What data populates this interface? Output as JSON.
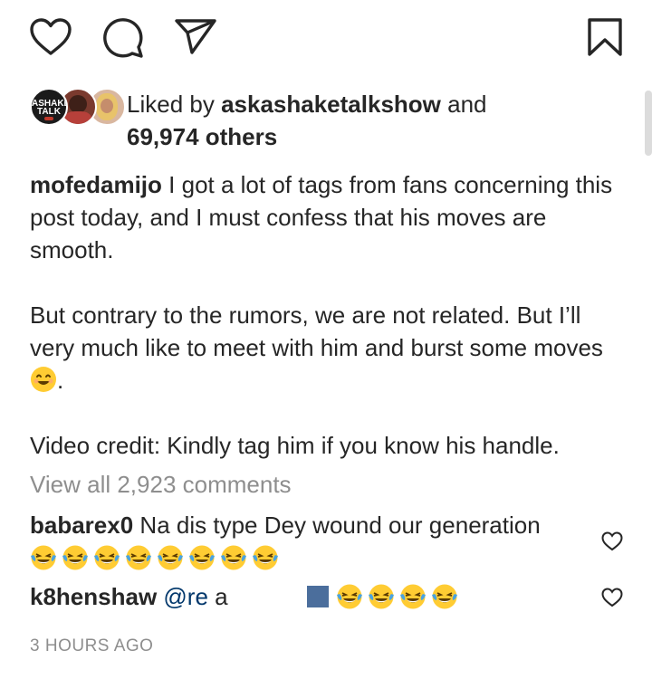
{
  "likes": {
    "prefix": "Liked by",
    "user": "askashaketalkshow",
    "and": "and",
    "others": "69,974 others",
    "avatar1_line1": "ASHAKE",
    "avatar1_line2": "TALK"
  },
  "caption": {
    "username": "mofedamijo",
    "para1": "I got a lot of tags from fans concerning this post today, and I must confess that his moves are smooth.",
    "para2": "But contrary to the rumors, we are not related. But I’ll very much like to meet with him and burst some moves",
    "para2_end": ".",
    "para3": "Video credit: Kindly tag him if you know his handle."
  },
  "view_all_comments": "View all 2,923 comments",
  "comments": [
    {
      "username": "babarex0",
      "text": "Na dis type Dey wound our generation",
      "emoji_count": 8
    },
    {
      "username": "k8henshaw",
      "mention": "@re",
      "fragment": "a",
      "emoji_count": 4
    }
  ],
  "timestamp": "3 HOURS AGO",
  "icons": [
    "heart-icon",
    "comment-icon",
    "share-icon",
    "bookmark-icon"
  ],
  "colors": {
    "text": "#262626",
    "muted": "#8e8e8e",
    "link": "#00376b"
  }
}
